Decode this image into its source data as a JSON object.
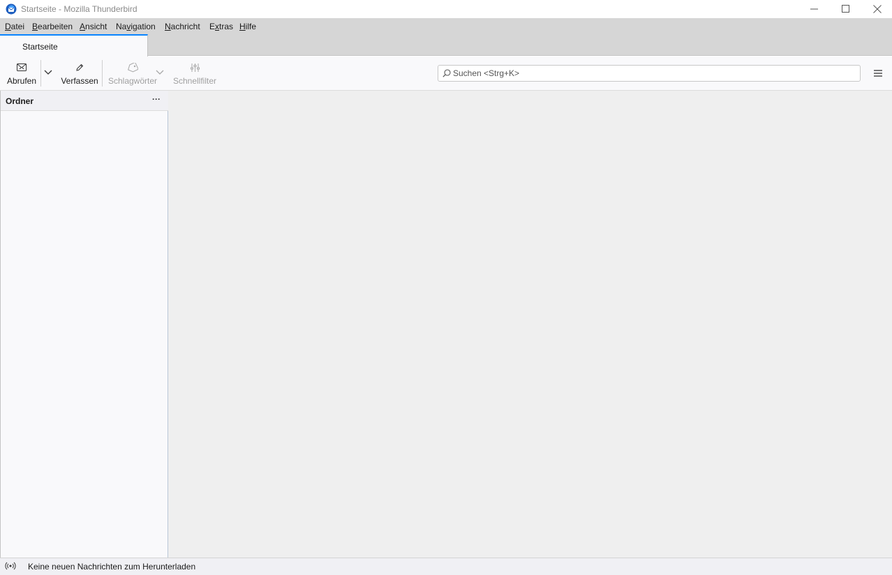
{
  "window": {
    "title": "Startseite - Mozilla Thunderbird"
  },
  "menubar": {
    "items": [
      {
        "underline": "D",
        "rest": "atei"
      },
      {
        "underline": "B",
        "rest": "earbeiten"
      },
      {
        "underline": "A",
        "rest": "nsicht"
      },
      {
        "underline": "Na",
        "rest": "vigation"
      },
      {
        "underline": "N",
        "rest": "achricht"
      },
      {
        "underline": "E",
        "rest": "xtras"
      },
      {
        "underline": "H",
        "rest": "ilfe"
      }
    ],
    "items_alt": {
      "navigation_prefix": "Na",
      "navigation_ul": "v",
      "navigation_suffix": "igation",
      "extras_prefix": "E",
      "extras_ul": "x",
      "extras_suffix": "tras"
    }
  },
  "tabs": [
    {
      "label": "Startseite",
      "active": true
    }
  ],
  "toolbar": {
    "get_messages": {
      "label": "Abrufen",
      "icon": "envelope-icon"
    },
    "compose": {
      "label": "Verfassen",
      "icon": "pencil-icon"
    },
    "tags": {
      "label": "Schlagwörter",
      "icon": "tag-icon",
      "disabled": true
    },
    "quick_filter": {
      "label": "Schnellfilter",
      "icon": "filter-sliders-icon",
      "disabled": true
    }
  },
  "search": {
    "placeholder": "Suchen <Strg+K>"
  },
  "folder_pane": {
    "title": "Ordner",
    "menu_glyph": "···"
  },
  "statusbar": {
    "text": "Keine neuen Nachrichten zum Herunterladen"
  },
  "colors": {
    "accent": "#0a84ff",
    "menubar_bg": "#d6d6d6",
    "toolbar_bg": "#f9f9fb",
    "content_bg": "#efefef"
  }
}
